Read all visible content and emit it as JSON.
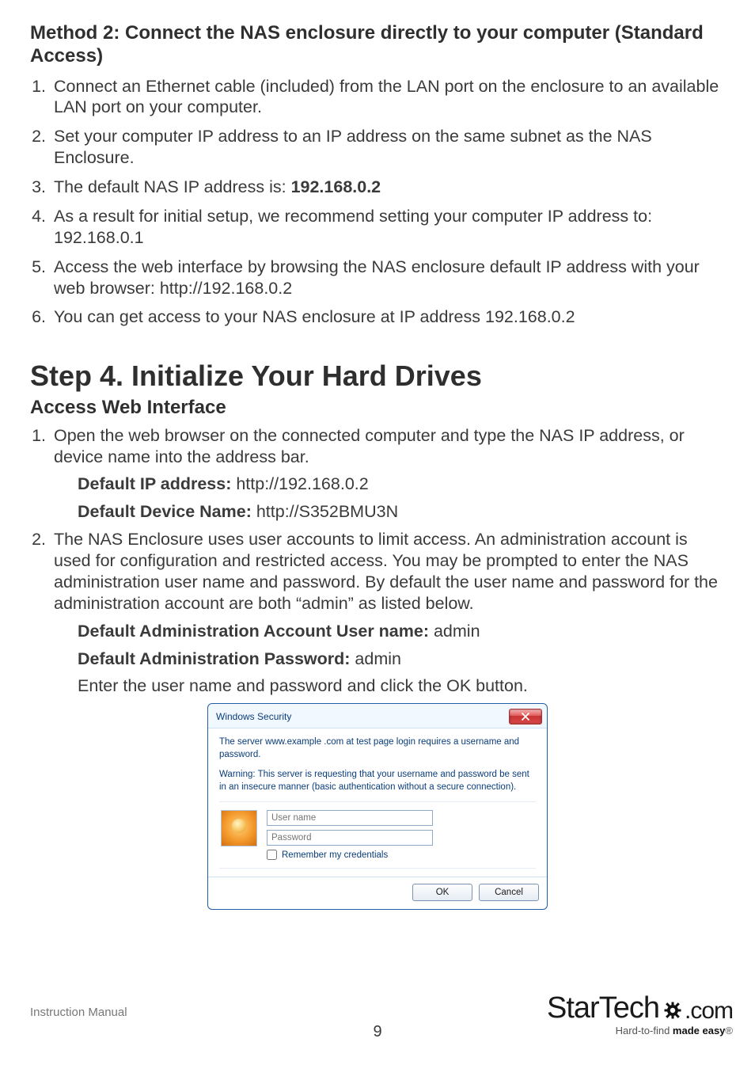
{
  "method2": {
    "heading": "Method 2: Connect the NAS enclosure directly to your computer (Standard Access)",
    "items": [
      "Connect an Ethernet cable (included) from the LAN port on the enclosure to an available LAN port on your computer.",
      "Set your computer IP address to an IP address on the same subnet as the NAS Enclosure.",
      {
        "pre": "The default NAS IP address is: ",
        "bold": "192.168.0.2"
      },
      "As a result for initial setup, we recommend setting your computer IP address to: 192.168.0.1",
      "Access the web interface by browsing the NAS enclosure default IP address with your web browser:  http://192.168.0.2",
      "You can get access to your NAS enclosure at IP address 192.168.0.2"
    ]
  },
  "step4": {
    "heading": "Step 4. Initialize Your Hard Drives",
    "subheading": "Access Web Interface",
    "item1": "Open the web browser on the connected computer and type the NAS IP address, or device name into the address bar.",
    "default_ip_label": "Default IP address:",
    "default_ip_value": " http://192.168.0.2",
    "default_name_label": "Default Device Name:",
    "default_name_value": " http://S352BMU3N",
    "item2": "The NAS Enclosure uses user accounts to limit access. An administration account is used for configuration and restricted access. You may be prompted to enter the NAS administration user name and password. By default the user name and password for the administration account are both “admin” as listed below.",
    "admin_user_label": "Default Administration Account User name:",
    "admin_user_value": " admin",
    "admin_pass_label": "Default Administration Password:",
    "admin_pass_value": " admin",
    "enter_line": "Enter the user name and password and click the OK button."
  },
  "dialog": {
    "title": "Windows Security",
    "msg1": "The server www.example .com at test page login requires a username and password.",
    "msg2": "Warning: This server is requesting that your username and password be sent in an insecure manner (basic authentication without a secure connection).",
    "username_placeholder": "User name",
    "password_placeholder": "Password",
    "remember": "Remember my credentials",
    "ok": "OK",
    "cancel": "Cancel"
  },
  "footer": {
    "label": "Instruction Manual",
    "page": "9",
    "logo_text": "StarTech",
    "logo_suffix": ".com",
    "tag_pre": "Hard-to-find ",
    "tag_bold": "made easy",
    "tag_suffix": "®"
  }
}
